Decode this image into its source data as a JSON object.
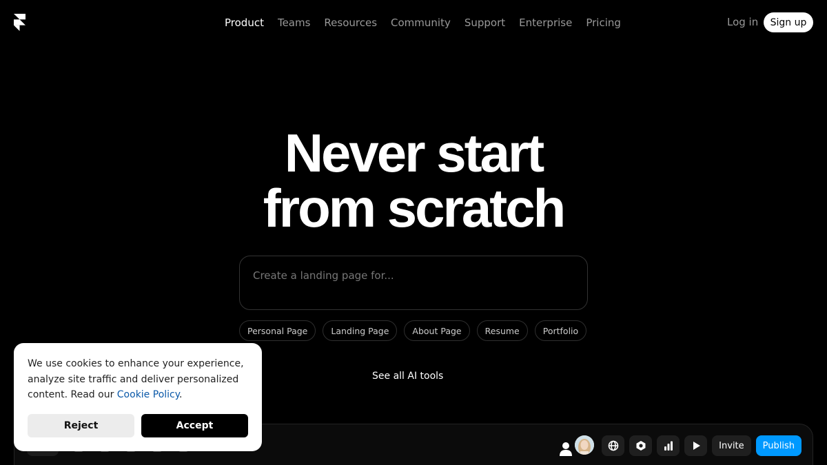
{
  "header": {
    "logo_icon": "framer-logo-icon",
    "nav": [
      {
        "label": "Product",
        "active": true
      },
      {
        "label": "Teams"
      },
      {
        "label": "Resources"
      },
      {
        "label": "Community"
      },
      {
        "label": "Support"
      },
      {
        "label": "Enterprise"
      },
      {
        "label": "Pricing"
      }
    ],
    "login_label": "Log in",
    "signup_label": "Sign up"
  },
  "hero": {
    "title_line1": "Never start",
    "title_line2": "from scratch",
    "prompt_placeholder": "Create a landing page for...",
    "chips": [
      "Personal Page",
      "Landing Page",
      "About Page",
      "Resume",
      "Portfolio"
    ],
    "see_all": "See all AI tools"
  },
  "editor_toolbar": {
    "icons": [
      "user-icon",
      "avatar-photo",
      "globe-icon",
      "hexagon-icon",
      "bar-chart-icon",
      "play-icon"
    ],
    "invite_label": "Invite",
    "publish_label": "Publish",
    "publish_color": "#0099ff"
  },
  "cookie_banner": {
    "text_before": "We use cookies to enhance your experience, analyze site traffic and deliver personalized content. Read our ",
    "link_label": "Cookie Policy",
    "text_after": ".",
    "reject_label": "Reject",
    "accept_label": "Accept",
    "link_color": "#0a58a8"
  }
}
